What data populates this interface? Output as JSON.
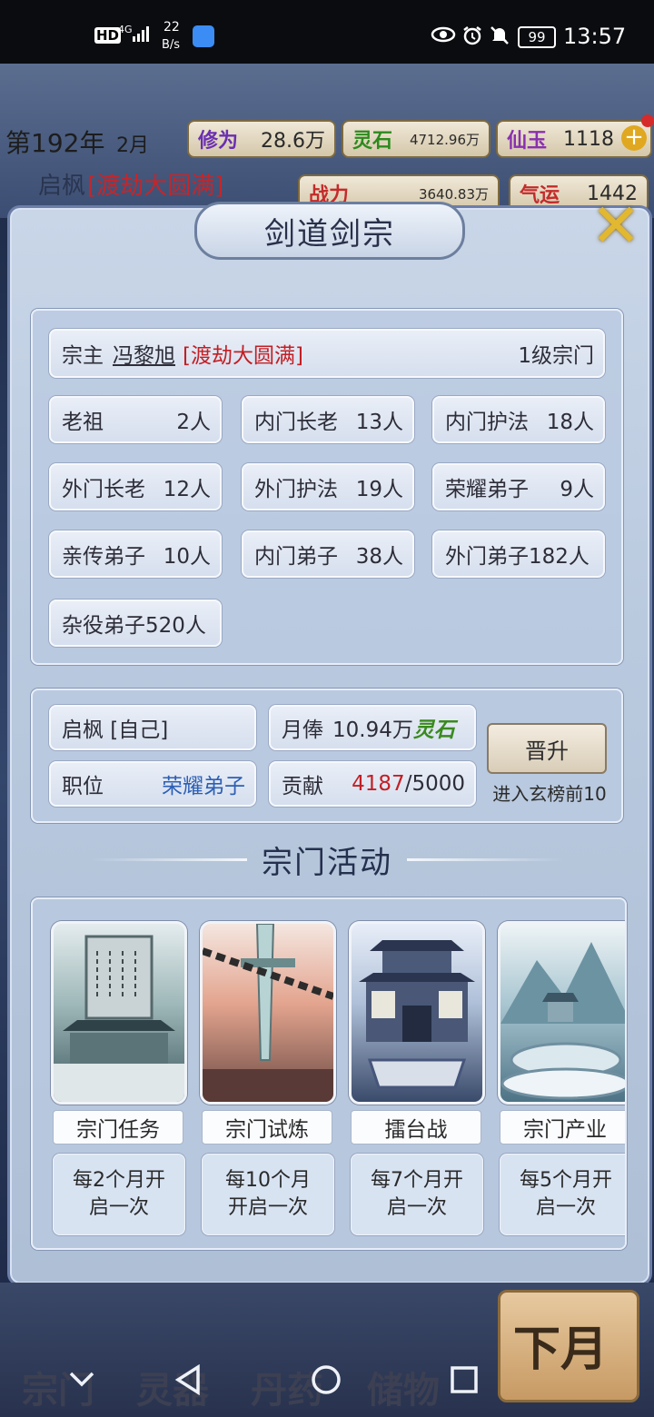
{
  "status_bar": {
    "hd": "HD",
    "net": "4G",
    "speed_value": "22",
    "speed_unit": "B/s",
    "battery": "99",
    "time": "13:57"
  },
  "hud": {
    "year": "第192年",
    "month": "2月",
    "cultivation_label": "修为",
    "cultivation_value": "28.6万",
    "spirit_stone_label": "灵石",
    "spirit_stone_value": "4712.96万",
    "jade_label": "仙玉",
    "jade_value": "1118",
    "character_name": "启枫",
    "character_realm": "渡劫大圆满",
    "power_label": "战力",
    "power_value": "3640.83万",
    "luck_label": "气运",
    "luck_value": "1442"
  },
  "dialog": {
    "title": "剑道剑宗"
  },
  "sect_info": {
    "leader_label": "宗主",
    "leader_name": "冯黎旭",
    "leader_realm": "渡劫大圆满",
    "sect_level": "1级宗门",
    "ranks": [
      {
        "label": "老祖",
        "count": "2人"
      },
      {
        "label": "内门长老",
        "count": "13人"
      },
      {
        "label": "内门护法",
        "count": "18人"
      },
      {
        "label": "外门长老",
        "count": "12人"
      },
      {
        "label": "外门护法",
        "count": "19人"
      },
      {
        "label": "荣耀弟子",
        "count": "9人"
      },
      {
        "label": "亲传弟子",
        "count": "10人"
      },
      {
        "label": "内门弟子",
        "count": "38人"
      },
      {
        "label": "外门弟子",
        "count": "182人"
      },
      {
        "label": "杂役弟子",
        "count": "520人"
      }
    ]
  },
  "self_info": {
    "name": "启枫 [自己]",
    "salary_label": "月俸",
    "salary_value": "10.94万",
    "salary_unit": "灵石",
    "position_label": "职位",
    "position_value": "荣耀弟子",
    "contribution_label": "贡献",
    "contribution_current": "4187",
    "contribution_total": "/5000",
    "promote_button": "晋升",
    "promote_note": "进入玄榜前10"
  },
  "activities": {
    "header": "宗门活动",
    "items": [
      {
        "name": "宗门任务",
        "desc_line1": "每2个月开",
        "desc_line2": "启一次"
      },
      {
        "name": "宗门试炼",
        "desc_line1": "每10个月",
        "desc_line2": "开启一次"
      },
      {
        "name": "擂台战",
        "desc_line1": "每7个月开",
        "desc_line2": "启一次"
      },
      {
        "name": "宗门产业",
        "desc_line1": "每5个月开",
        "desc_line2": "启一次"
      }
    ]
  },
  "bottom_nav": {
    "items": [
      "宗门",
      "灵器",
      "丹药",
      "储物"
    ],
    "next_month": "下月"
  },
  "colors": {
    "accent_gold": "#e2b830",
    "realm_red": "#c21f24",
    "position_blue": "#2d5fb5"
  }
}
